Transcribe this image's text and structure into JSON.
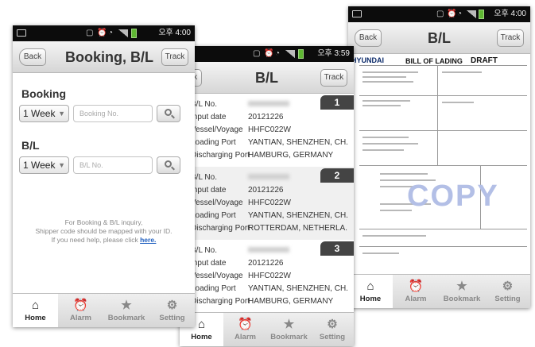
{
  "status_bar": {
    "time_left": "오후 4:00",
    "time_middle": "오후 3:59",
    "time_right": "오후 4:00"
  },
  "screen_booking": {
    "title": "Booking, B/L",
    "back_label": "Back",
    "track_label": "Track",
    "booking_label": "Booking",
    "booking_period": "1 Week",
    "booking_placeholder": "Booking No.",
    "bl_label": "B/L",
    "bl_period": "1 Week",
    "bl_placeholder": "B/L No.",
    "note_line1": "For Booking & B/L inquiry,",
    "note_line2": "Shipper code should be mapped with your ID.",
    "note_line3": "If you need help, please click",
    "note_link": "here."
  },
  "screen_list": {
    "title": "B/L",
    "back_label": "Back",
    "track_label": "Track",
    "field_labels": {
      "bl_no": "B/L No.",
      "input_date": "Input date",
      "vessel": "Vessel/Voyage",
      "loading": "Loading Port",
      "discharging": "Discharging Port"
    },
    "items": [
      {
        "number": "1",
        "input_date": "20121226",
        "vessel": "HHFC022W",
        "loading": "YANTIAN, SHENZHEN, CH.",
        "discharging": "HAMBURG, GERMANY"
      },
      {
        "number": "2",
        "input_date": "20121226",
        "vessel": "HHFC022W",
        "loading": "YANTIAN, SHENZHEN, CH.",
        "discharging": "ROTTERDAM, NETHERLA."
      },
      {
        "number": "3",
        "input_date": "20121226",
        "vessel": "HHFC022W",
        "loading": "YANTIAN, SHENZHEN, CH.",
        "discharging": "HAMBURG, GERMANY"
      }
    ]
  },
  "screen_doc": {
    "title": "B/L",
    "back_label": "Back",
    "track_label": "Track",
    "doc_company": "HYUNDAI",
    "doc_heading": "BILL OF LADING",
    "doc_status": "DRAFT",
    "watermark": "COPY"
  },
  "tabs": [
    {
      "label": "Home",
      "icon": "home-icon"
    },
    {
      "label": "Alarm",
      "icon": "alarm-icon"
    },
    {
      "label": "Bookmark",
      "icon": "bookmark-icon"
    },
    {
      "label": "Setting",
      "icon": "gear-icon"
    }
  ]
}
